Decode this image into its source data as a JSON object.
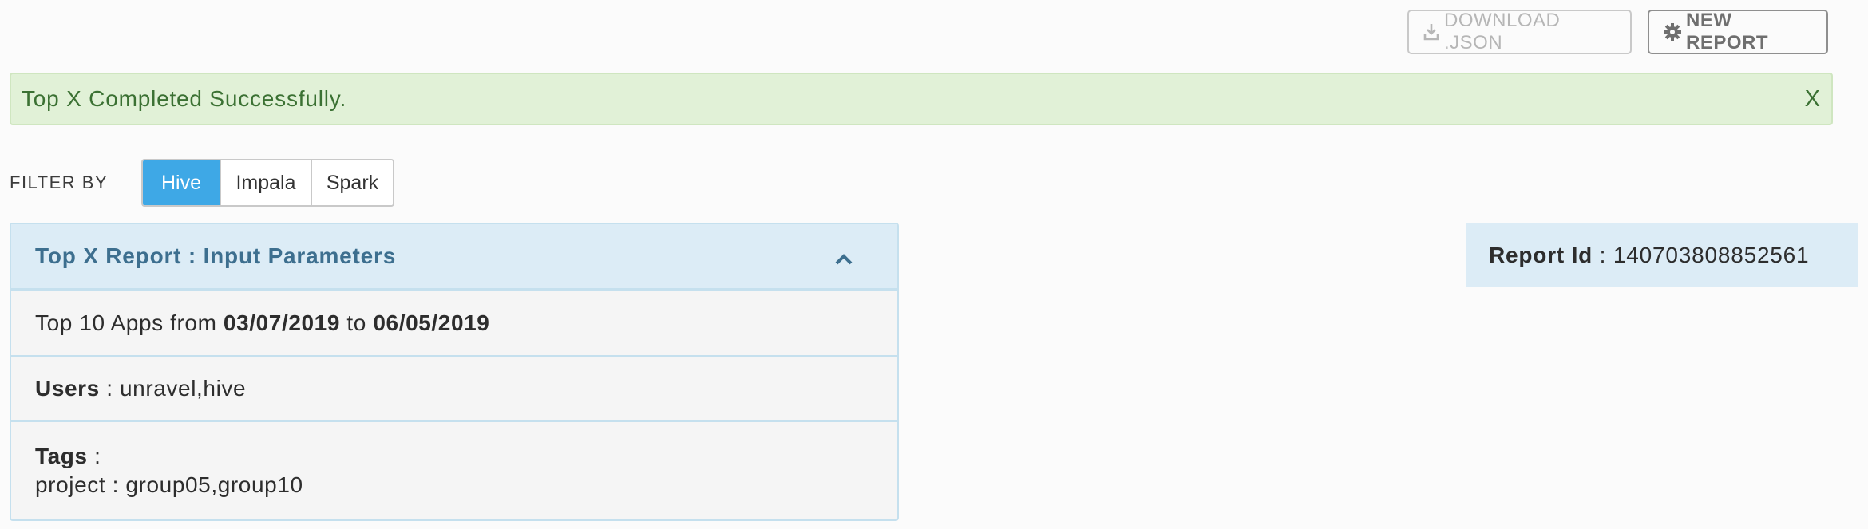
{
  "toolbar": {
    "download_label": "DOWNLOAD .JSON",
    "download_icon": "download-icon",
    "new_report_label": "NEW REPORT",
    "new_report_icon": "gear-icon"
  },
  "alert": {
    "message": "Top X Completed Successfully.",
    "close_label": "X"
  },
  "filter": {
    "label": "FILTER BY",
    "options": [
      "Hive",
      "Impala",
      "Spark"
    ],
    "selected": "Hive"
  },
  "panel": {
    "title": "Top X Report : Input Parameters",
    "collapse_icon": "chevron-up-icon",
    "apps_prefix": "Top 10 Apps from ",
    "date_from": "03/07/2019",
    "date_sep": " to ",
    "date_to": "06/05/2019",
    "users_label": "Users",
    "users_sep": " : ",
    "users_value": "unravel,hive",
    "tags_label": "Tags",
    "tags_sep": " :",
    "tags_value": "project : group05,group10"
  },
  "report": {
    "id_label": "Report Id",
    "id_sep": " : ",
    "id_value": "140703808852561"
  },
  "colors": {
    "accent": "#3ea8e6",
    "success_bg": "#e1f1d7",
    "success_text": "#3b7133",
    "panel_header_bg": "#dcecf6",
    "panel_title": "#3d6f8f"
  }
}
